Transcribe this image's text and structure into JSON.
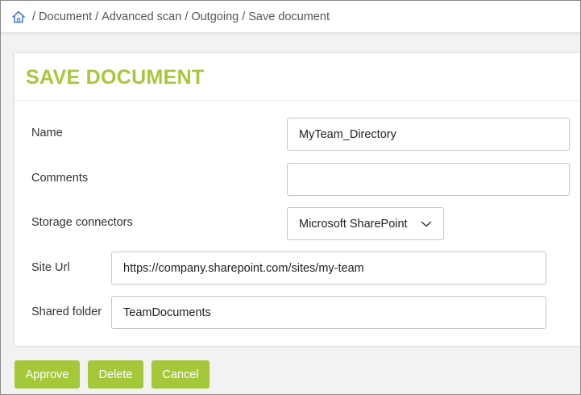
{
  "breadcrumb": {
    "home_icon": "home-icon",
    "separator": "/",
    "items": [
      "Document",
      "Advanced scan",
      "Outgoing",
      "Save document"
    ]
  },
  "card": {
    "title": "SAVE DOCUMENT"
  },
  "form": {
    "name_label": "Name",
    "name_value": "MyTeam_Directory",
    "comments_label": "Comments",
    "comments_value": "",
    "storage_label": "Storage connectors",
    "storage_value": "Microsoft SharePoint",
    "site_url_label": "Site Url",
    "site_url_value": "https://company.sharepoint.com/sites/my-team",
    "shared_folder_label": "Shared folder",
    "shared_folder_value": "TeamDocuments"
  },
  "actions": {
    "approve_label": "Approve",
    "delete_label": "Delete",
    "cancel_label": "Cancel"
  },
  "colors": {
    "accent": "#a5c83a",
    "home_icon": "#4a7fd4"
  }
}
